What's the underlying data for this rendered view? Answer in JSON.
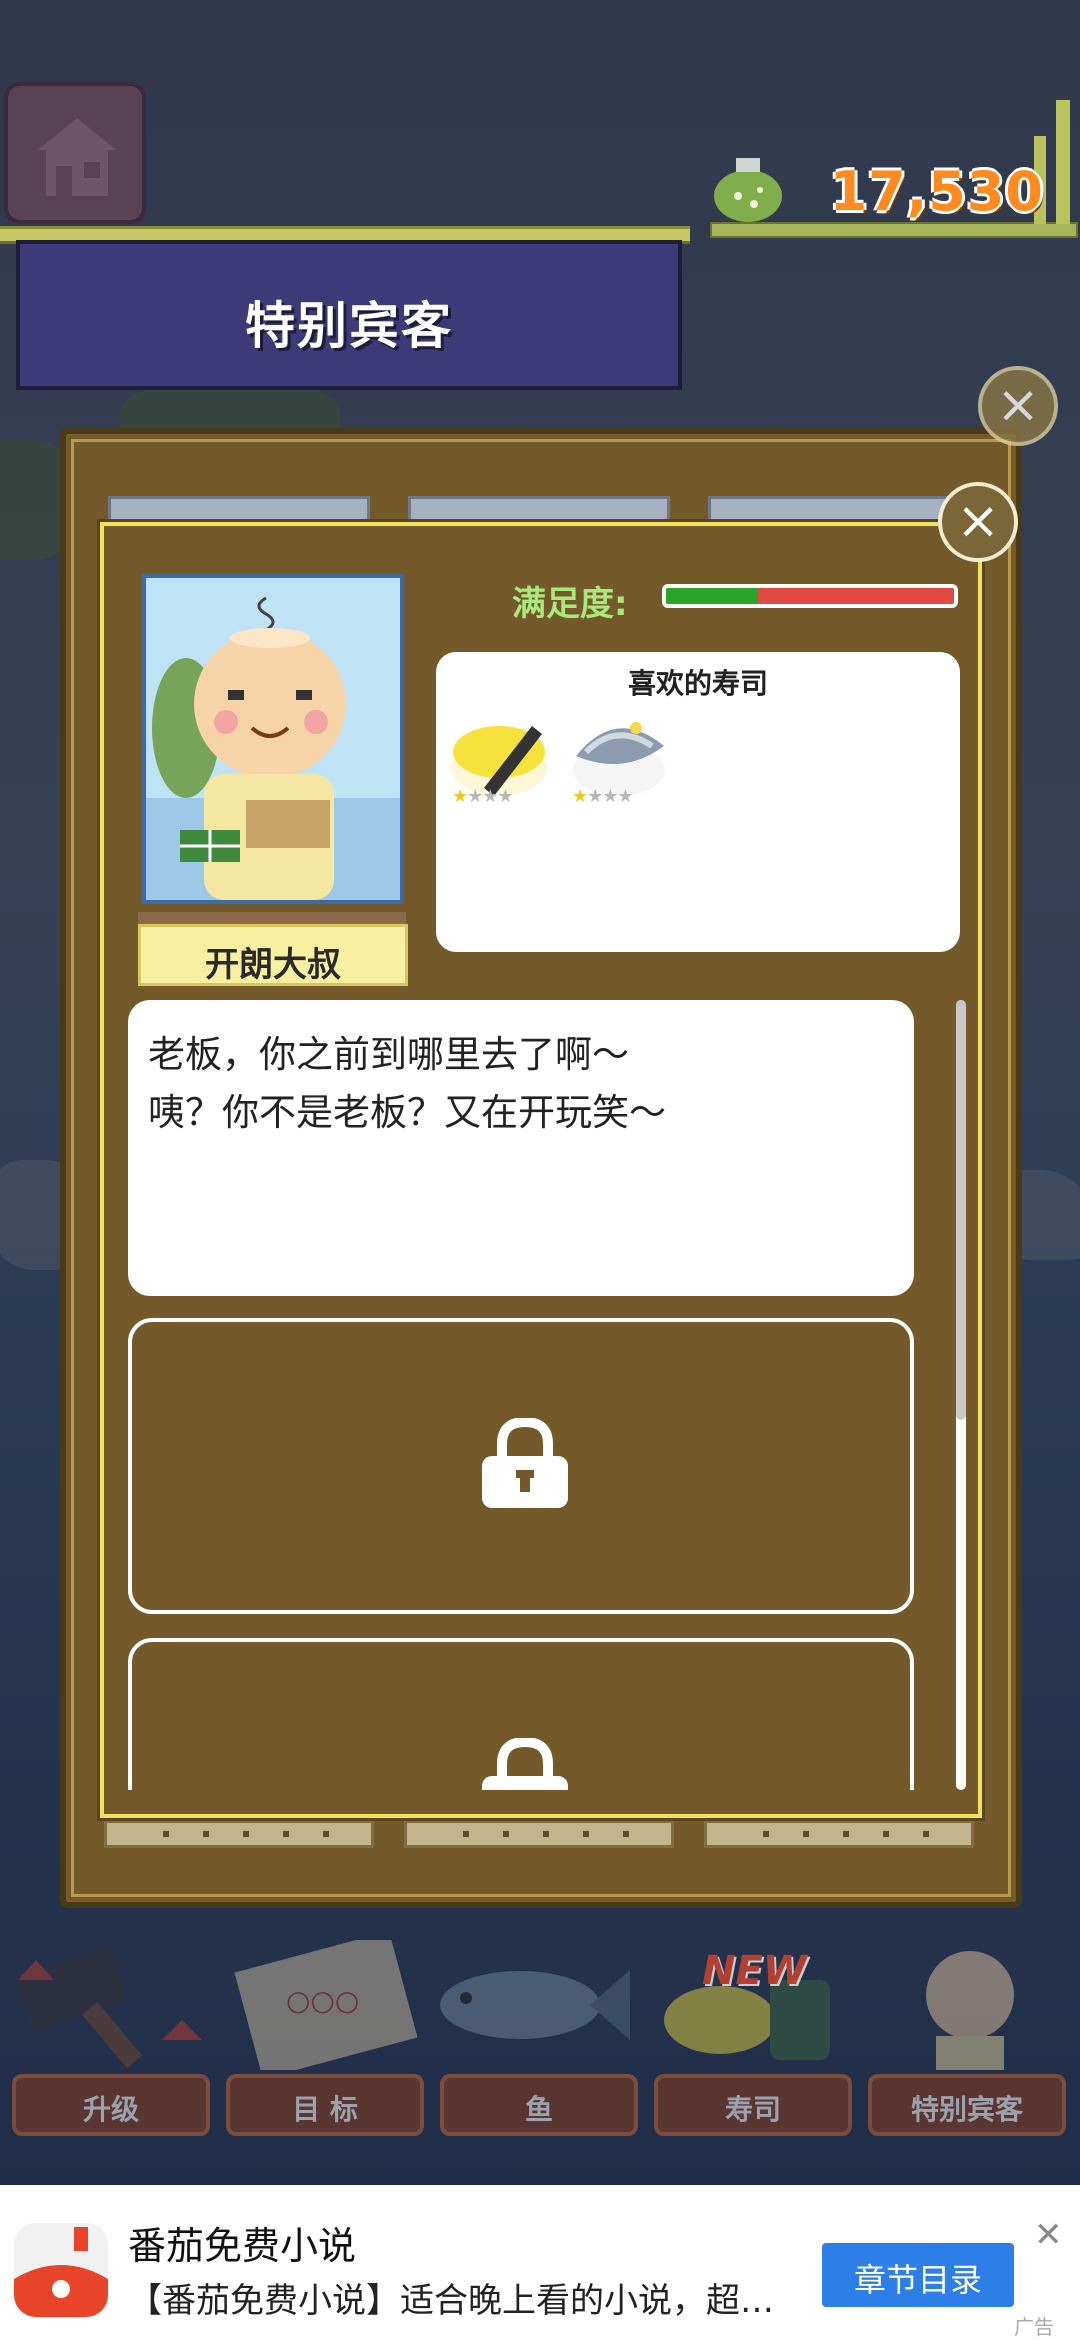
{
  "colors": {
    "banner_bg": "#3c3a78",
    "panel_bg": "#74592a",
    "panel_border": "#f2e05c",
    "money": "#ff8a1e",
    "satisfaction_label": "#a9e87a",
    "satisfaction_good": "#2aa52a",
    "satisfaction_bad": "#e04a40",
    "ad_button": "#2d7ee6"
  },
  "header": {
    "home_icon": "house-icon",
    "banner_title": "特别宾客",
    "money": "17,530",
    "money_icon": "money-bag-icon"
  },
  "guest": {
    "name": "开朗大叔",
    "satisfaction_label": "满足度:",
    "satisfaction_ratio": 0.32,
    "favorite_title": "喜欢的寿司",
    "favorites": [
      {
        "icon": "tamago-sushi-icon",
        "stars": 1,
        "max_stars": 4
      },
      {
        "icon": "mackerel-sushi-icon",
        "stars": 1,
        "max_stars": 4
      }
    ],
    "dialog_lines": [
      "老板，你之前到哪里去了啊～",
      "咦？你不是老板？又在开玩笑～"
    ],
    "locked_slots": 2,
    "lock_icon": "padlock-icon"
  },
  "nav": {
    "items": [
      {
        "label": "升级",
        "icon": "hammer-icon"
      },
      {
        "label": "目 标",
        "icon": "goal-chart-icon"
      },
      {
        "label": "鱼",
        "icon": "fish-icon"
      },
      {
        "label": "寿司",
        "icon": "sushi-icon",
        "badge": "NEW"
      },
      {
        "label": "特别宾客",
        "icon": "guest-icon"
      }
    ]
  },
  "ad": {
    "title": "番茄免费小说",
    "description": "【番茄免费小说】适合晚上看的小说，超…",
    "button": "章节目录",
    "close": "✕",
    "tag": "广告"
  }
}
